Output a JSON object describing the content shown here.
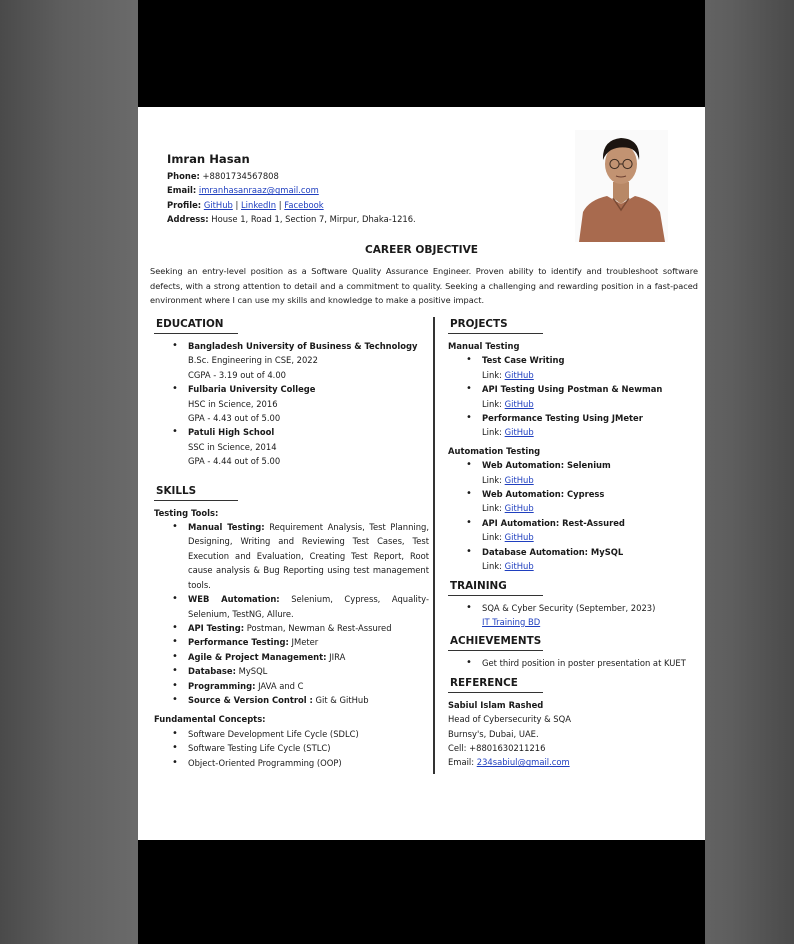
{
  "header": {
    "name": "Imran Hasan",
    "phone_label": "Phone:",
    "phone": "+8801734567808",
    "email_label": "Email:",
    "email": "imranhasanraaz@gmail.com",
    "profile_label": "Profile:",
    "profile_links": [
      "GitHub",
      "LinkedIn",
      "Facebook"
    ],
    "profile_sep": "|",
    "address_label": "Address:",
    "address": "House 1, Road 1, Section 7, Mirpur, Dhaka-1216."
  },
  "objective": {
    "title": "CAREER OBJECTIVE",
    "text": "Seeking an entry-level position as a Software Quality Assurance Engineer. Proven ability to identify and troubleshoot software defects, with a strong attention to detail and a commitment to quality. Seeking a challenging and rewarding position in a fast-paced environment where I can use my skills and knowledge to make a positive impact."
  },
  "education": {
    "title": "EDUCATION",
    "items": [
      {
        "school": "Bangladesh University of Business & Technology",
        "degree": "B.Sc. Engineering in CSE, 2022",
        "grade": "CGPA - 3.19 out of 4.00"
      },
      {
        "school": "Fulbaria University College",
        "degree": "HSC in Science, 2016",
        "grade": "GPA - 4.43 out of 5.00"
      },
      {
        "school": "Patuli High School",
        "degree": "SSC in Science, 2014",
        "grade": "GPA - 4.44 out of 5.00"
      }
    ]
  },
  "skills": {
    "title": "SKILLS",
    "tools_title": "Testing Tools:",
    "tools": [
      {
        "label": "Manual Testing:",
        "text": "Requirement Analysis, Test Planning, Designing, Writing and Reviewing Test Cases, Test Execution and Evaluation, Creating Test Report, Root cause analysis & Bug Reporting using test management tools."
      },
      {
        "label": "WEB Automation:",
        "text": "Selenium, Cypress, Aquality-Selenium, TestNG, Allure."
      },
      {
        "label": "API Testing:",
        "text": "Postman, Newman & Rest-Assured"
      },
      {
        "label": "Performance Testing:",
        "text": "JMeter"
      },
      {
        "label": "Agile & Project Management:",
        "text": "JIRA"
      },
      {
        "label": "Database:",
        "text": "MySQL"
      },
      {
        "label": "Programming:",
        "text": "JAVA and C"
      },
      {
        "label": "Source & Version Control :",
        "text": "Git & GitHub"
      }
    ],
    "concepts_title": "Fundamental Concepts:",
    "concepts": [
      "Software Development Life Cycle (SDLC)",
      "Software Testing Life Cycle (STLC)",
      "Object-Oriented Programming (OOP)"
    ]
  },
  "projects": {
    "title": "PROJECTS",
    "manual_title": "Manual Testing",
    "manual": [
      {
        "name": "Test Case Writing",
        "link_label": "Link:",
        "link": "GitHub"
      },
      {
        "name": "API Testing Using Postman & Newman",
        "link_label": "Link:",
        "link": "GitHub"
      },
      {
        "name": "Performance Testing Using JMeter",
        "link_label": "Link:",
        "link": "GitHub"
      }
    ],
    "auto_title": "Automation Testing",
    "auto": [
      {
        "name": "Web Automation: Selenium",
        "link_label": "Link:",
        "link": "GitHub"
      },
      {
        "name": "Web Automation: Cypress",
        "link_label": "Link:",
        "link": "GitHub"
      },
      {
        "name": "API Automation: Rest-Assured",
        "link_label": "Link:",
        "link": "GitHub"
      },
      {
        "name": "Database Automation: MySQL",
        "link_label": "Link:",
        "link": "GitHub"
      }
    ]
  },
  "training": {
    "title": "TRAINING",
    "items": [
      {
        "name": "SQA & Cyber Security (September, 2023)",
        "provider": "IT Training BD"
      }
    ]
  },
  "achievements": {
    "title": "ACHIEVEMENTS",
    "items": [
      "Get third position in poster presentation at KUET"
    ]
  },
  "reference": {
    "title": "REFERENCE",
    "name": "Sabiul Islam Rashed",
    "position": "Head of Cybersecurity & SQA",
    "company": "Burnsy's, Dubai, UAE.",
    "cell": "Cell: +8801630211216",
    "email_label": "Email:",
    "email": "234sabiul@gmail.com"
  },
  "colors": {
    "link": "#1f3fbf",
    "letterbox": "#000000",
    "page": "#ffffff"
  }
}
